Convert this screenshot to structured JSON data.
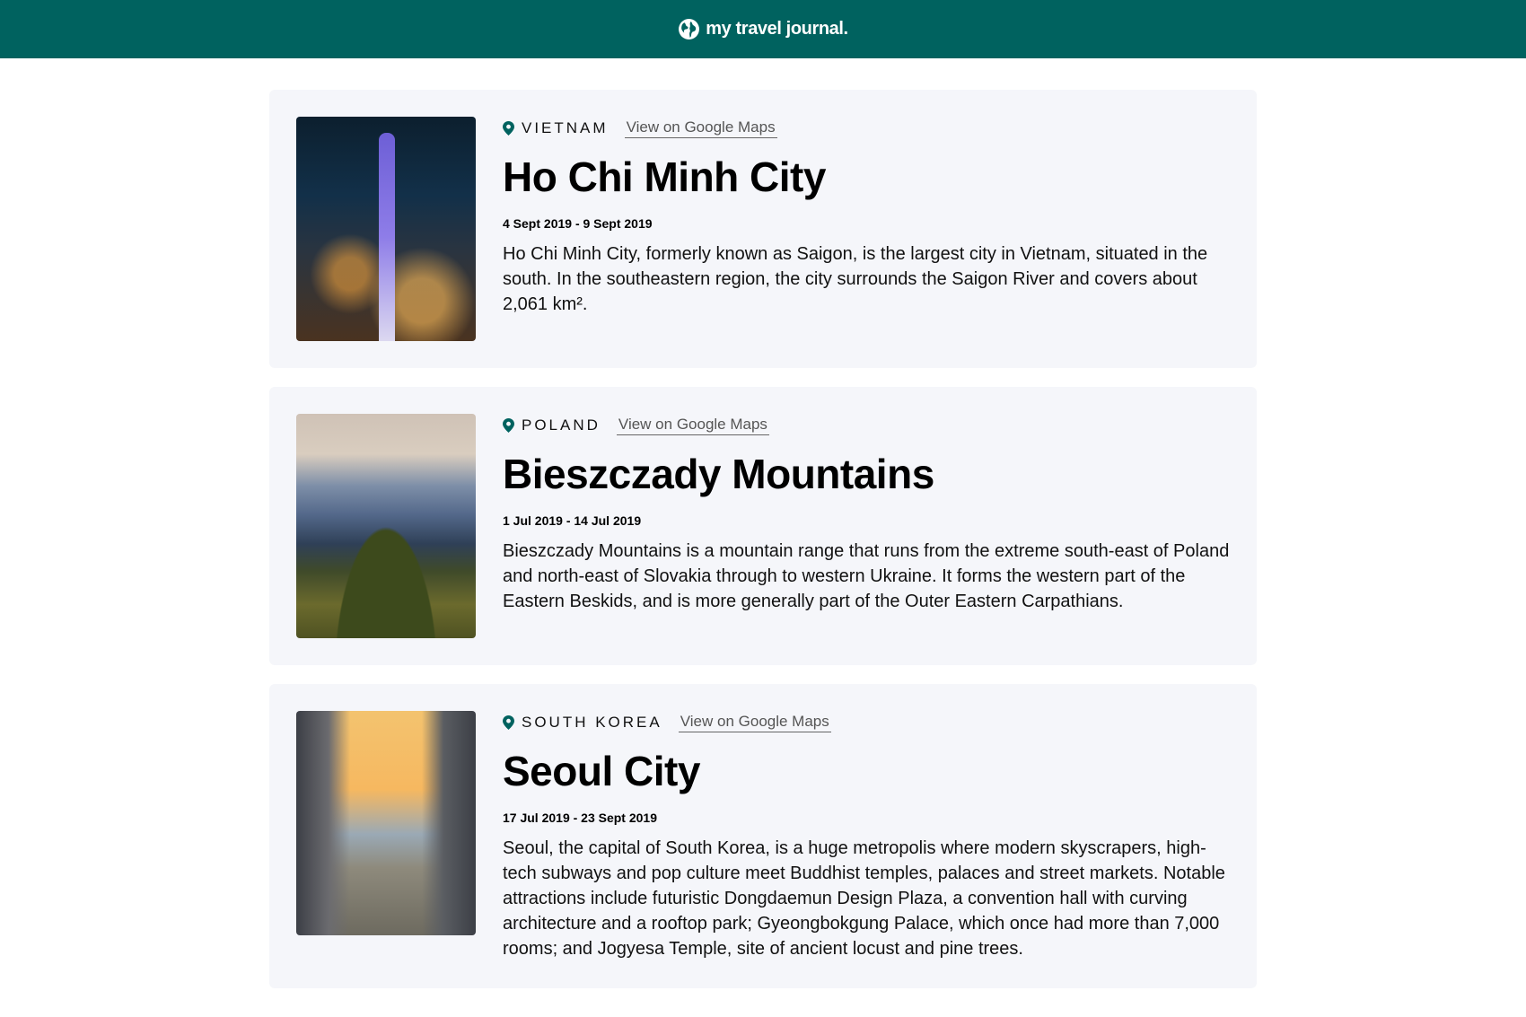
{
  "header": {
    "title": "my travel journal.",
    "logo_icon": "globe-icon",
    "background_color": "#00625f"
  },
  "entries": [
    {
      "country": "VIETNAM",
      "maps_link_label": "View on Google Maps",
      "title": "Ho Chi Minh City",
      "dates": "4 Sept 2019 - 9 Sept 2019",
      "description": "Ho Chi Minh City, formerly known as Saigon, is the largest city in Vietnam, situated in the south. In the southeastern region, the city surrounds the Saigon River and covers about 2,061 km².",
      "image_icon": "city-skyline-photo"
    },
    {
      "country": "POLAND",
      "maps_link_label": "View on Google Maps",
      "title": "Bieszczady Mountains",
      "dates": "1 Jul 2019 - 14 Jul 2019",
      "description": "Bieszczady Mountains is a mountain range that runs from the extreme south-east of Poland and north-east of Slovakia through to western Ukraine. It forms the western part of the Eastern Beskids, and is more generally part of the Outer Eastern Carpathians.",
      "image_icon": "mountain-landscape-photo"
    },
    {
      "country": "SOUTH KOREA",
      "maps_link_label": "View on Google Maps",
      "title": "Seoul City",
      "dates": "17 Jul 2019 - 23 Sept 2019",
      "description": "Seoul, the capital of South Korea, is a huge metropolis where modern skyscrapers, high-tech subways and pop culture meet Buddhist temples, palaces and street markets. Notable attractions include futuristic Dongdaemun Design Plaza, a convention hall with curving architecture and a rooftop park; Gyeongbokgung Palace, which once had more than 7,000 rooms; and Jogyesa Temple, site of ancient locust and pine trees.",
      "image_icon": "city-stream-photo"
    }
  ],
  "colors": {
    "accent": "#00625f",
    "card_background": "#f5f6fa",
    "link_text": "#555555"
  }
}
